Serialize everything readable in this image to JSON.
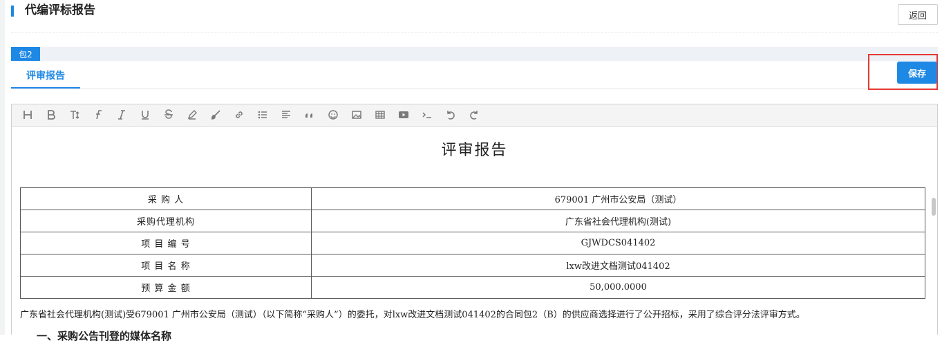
{
  "header": {
    "title": "代编评标报告",
    "back_label": "返回"
  },
  "package": {
    "badge": "包2"
  },
  "tabs": [
    {
      "label": "评审报告",
      "active": true
    }
  ],
  "actions": {
    "save_label": "保存"
  },
  "toolbar": {
    "icons": [
      "heading-icon",
      "bold-icon",
      "text-size-icon",
      "font-icon",
      "italic-icon",
      "underline-icon",
      "strikethrough-icon",
      "highlight-icon",
      "brush-icon",
      "link-icon",
      "bullet-list-icon",
      "align-icon",
      "quote-icon",
      "emoji-icon",
      "image-icon",
      "table-icon",
      "video-icon",
      "code-icon",
      "undo-icon",
      "redo-icon"
    ]
  },
  "document": {
    "title": "评审报告",
    "table": [
      {
        "label": "采 购 人",
        "value": "679001 广州市公安局（测试）"
      },
      {
        "label": "采购代理机构",
        "value": "广东省社会代理机构(测试)"
      },
      {
        "label": "项 目 编 号",
        "value": "GJWDCS041402"
      },
      {
        "label": "项 目 名 称",
        "value": "lxw改进文档测试041402"
      },
      {
        "label": "预 算 金 额",
        "value": "50,000.0000"
      }
    ],
    "paragraph": "广东省社会代理机构(测试)受679001 广州市公安局（测试）（以下简称“采购人”）的委托，对lxw改进文档测试041402的合同包2（B）的供应商选择进行了公开招标，采用了综合评分法评审方式。",
    "next_heading": "一、采购公告刊登的媒体名称"
  },
  "colors": {
    "accent": "#1e88e5",
    "highlight_frame": "#e53935"
  }
}
